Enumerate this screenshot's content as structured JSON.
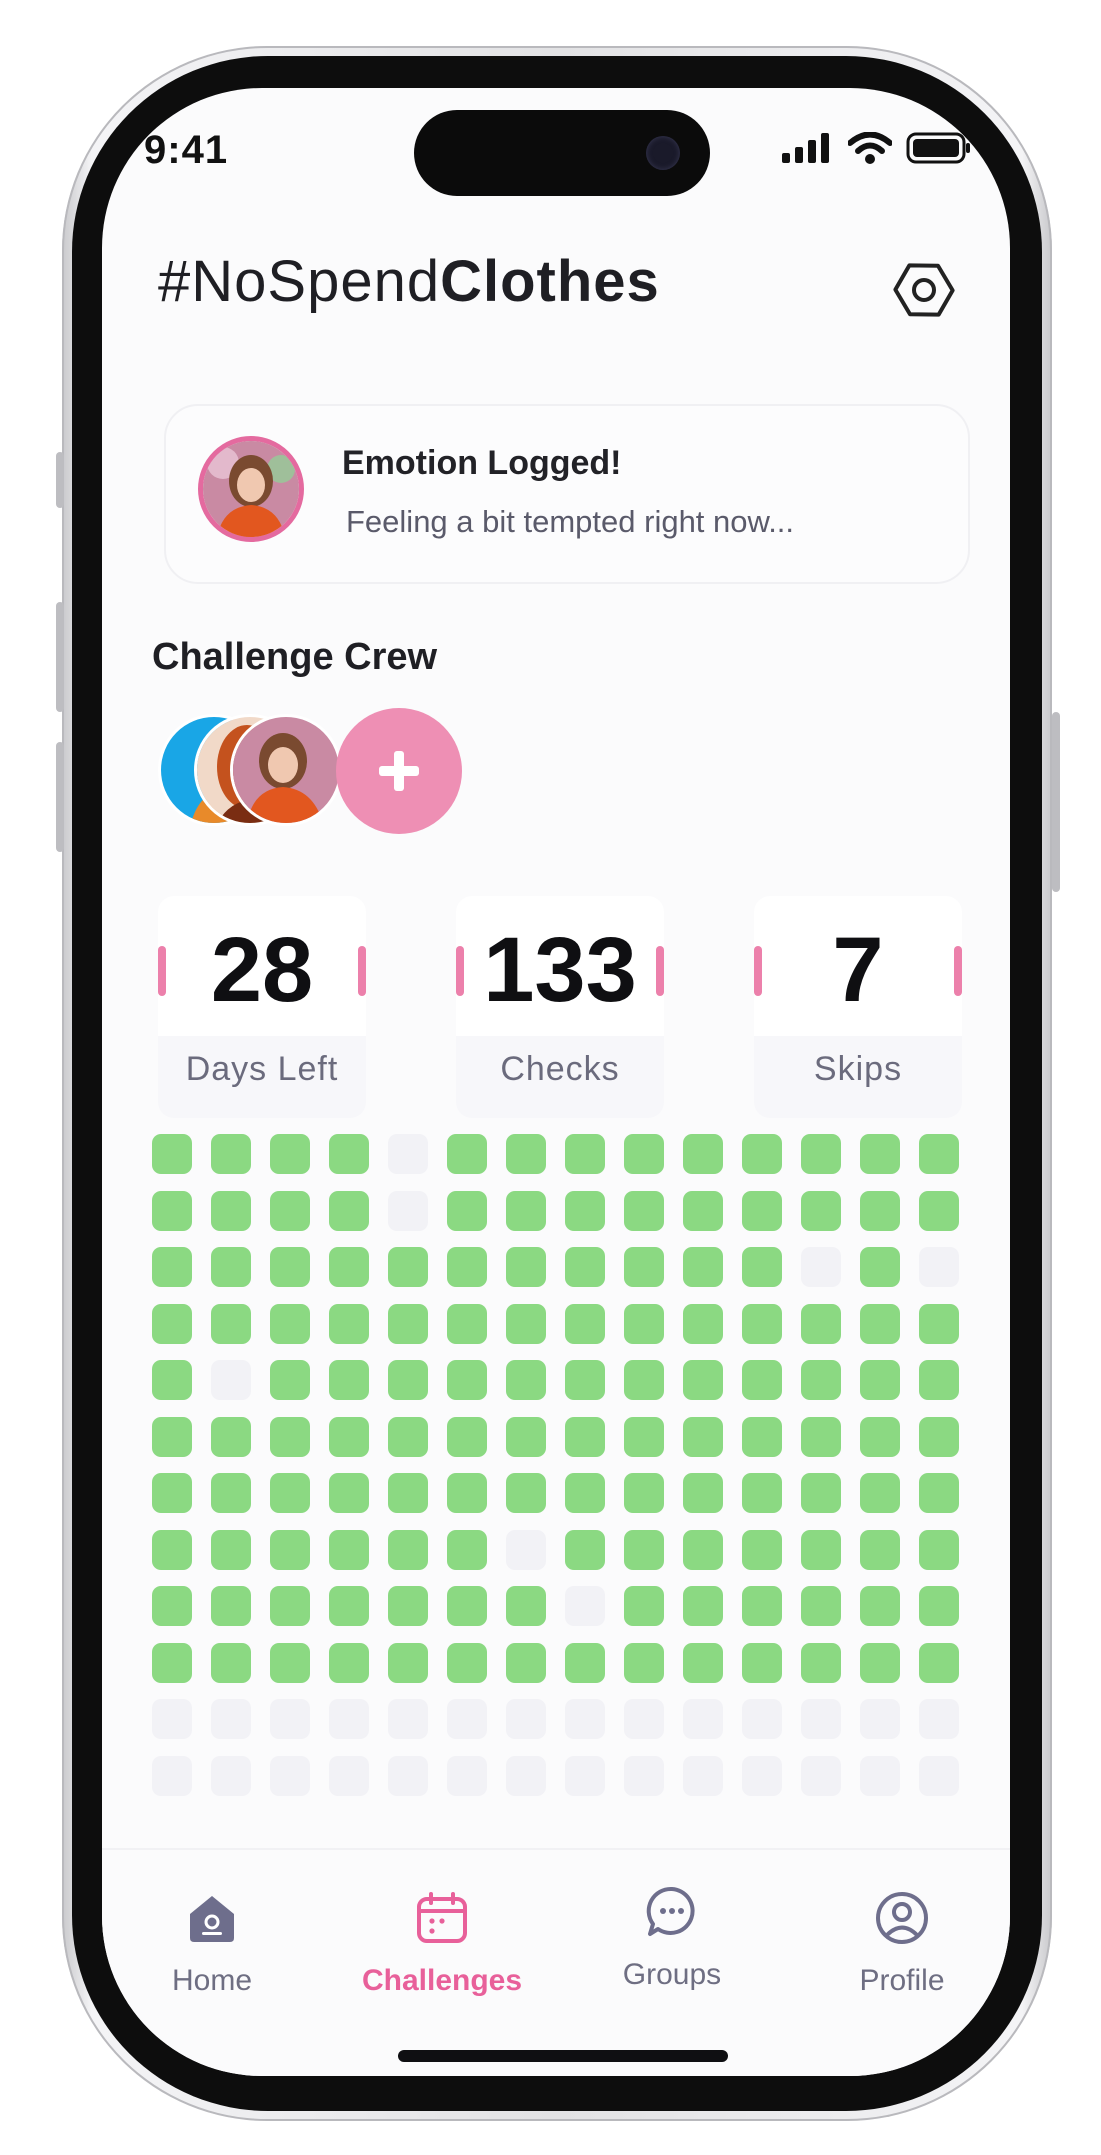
{
  "status_bar": {
    "time": "9:41"
  },
  "header": {
    "title_prefix": "#NoSpend",
    "title_bold": "Clothes",
    "settings_icon": "settings-hexagon-icon"
  },
  "toast": {
    "title": "Emotion Logged!",
    "message": "Feeling a bit tempted right now..."
  },
  "crew": {
    "heading": "Challenge Crew",
    "add_icon": "plus-icon"
  },
  "stats": [
    {
      "value": "28",
      "label": "Days Left"
    },
    {
      "value": "133",
      "label": "Checks"
    },
    {
      "value": "7",
      "label": "Skips"
    }
  ],
  "tracker": {
    "columns": 14,
    "rows": [
      [
        1,
        1,
        1,
        1,
        0,
        1,
        1,
        1,
        1,
        1,
        1,
        1,
        1,
        1
      ],
      [
        1,
        1,
        1,
        1,
        0,
        1,
        1,
        1,
        1,
        1,
        1,
        1,
        1,
        1
      ],
      [
        1,
        1,
        1,
        1,
        1,
        1,
        1,
        1,
        1,
        1,
        1,
        0,
        1,
        0
      ],
      [
        1,
        1,
        1,
        1,
        1,
        1,
        1,
        1,
        1,
        1,
        1,
        1,
        1,
        1
      ],
      [
        1,
        0,
        1,
        1,
        1,
        1,
        1,
        1,
        1,
        1,
        1,
        1,
        1,
        1
      ],
      [
        1,
        1,
        1,
        1,
        1,
        1,
        1,
        1,
        1,
        1,
        1,
        1,
        1,
        1
      ],
      [
        1,
        1,
        1,
        1,
        1,
        1,
        1,
        1,
        1,
        1,
        1,
        1,
        1,
        1
      ],
      [
        1,
        1,
        1,
        1,
        1,
        1,
        0,
        1,
        1,
        1,
        1,
        1,
        1,
        1
      ],
      [
        1,
        1,
        1,
        1,
        1,
        1,
        1,
        0,
        1,
        1,
        1,
        1,
        1,
        1
      ],
      [
        1,
        1,
        1,
        1,
        1,
        1,
        1,
        1,
        1,
        1,
        1,
        1,
        1,
        1
      ],
      [
        0,
        0,
        0,
        0,
        0,
        0,
        0,
        0,
        0,
        0,
        0,
        0,
        0,
        0
      ],
      [
        0,
        0,
        0,
        0,
        0,
        0,
        0,
        0,
        0,
        0,
        0,
        0,
        0,
        0
      ]
    ],
    "checked_color": "#8bd982",
    "empty_color": "#f2f2f6"
  },
  "tabs": [
    {
      "label": "Home",
      "icon": "home-icon",
      "active": false
    },
    {
      "label": "Challenges",
      "icon": "calendar-icon",
      "active": true
    },
    {
      "label": "Groups",
      "icon": "chat-bubble-icon",
      "active": false
    },
    {
      "label": "Profile",
      "icon": "user-circle-icon",
      "active": false
    }
  ],
  "colors": {
    "accent": "#e8609a",
    "text_dark": "#1f1f24",
    "text_muted": "#6e6e82"
  }
}
